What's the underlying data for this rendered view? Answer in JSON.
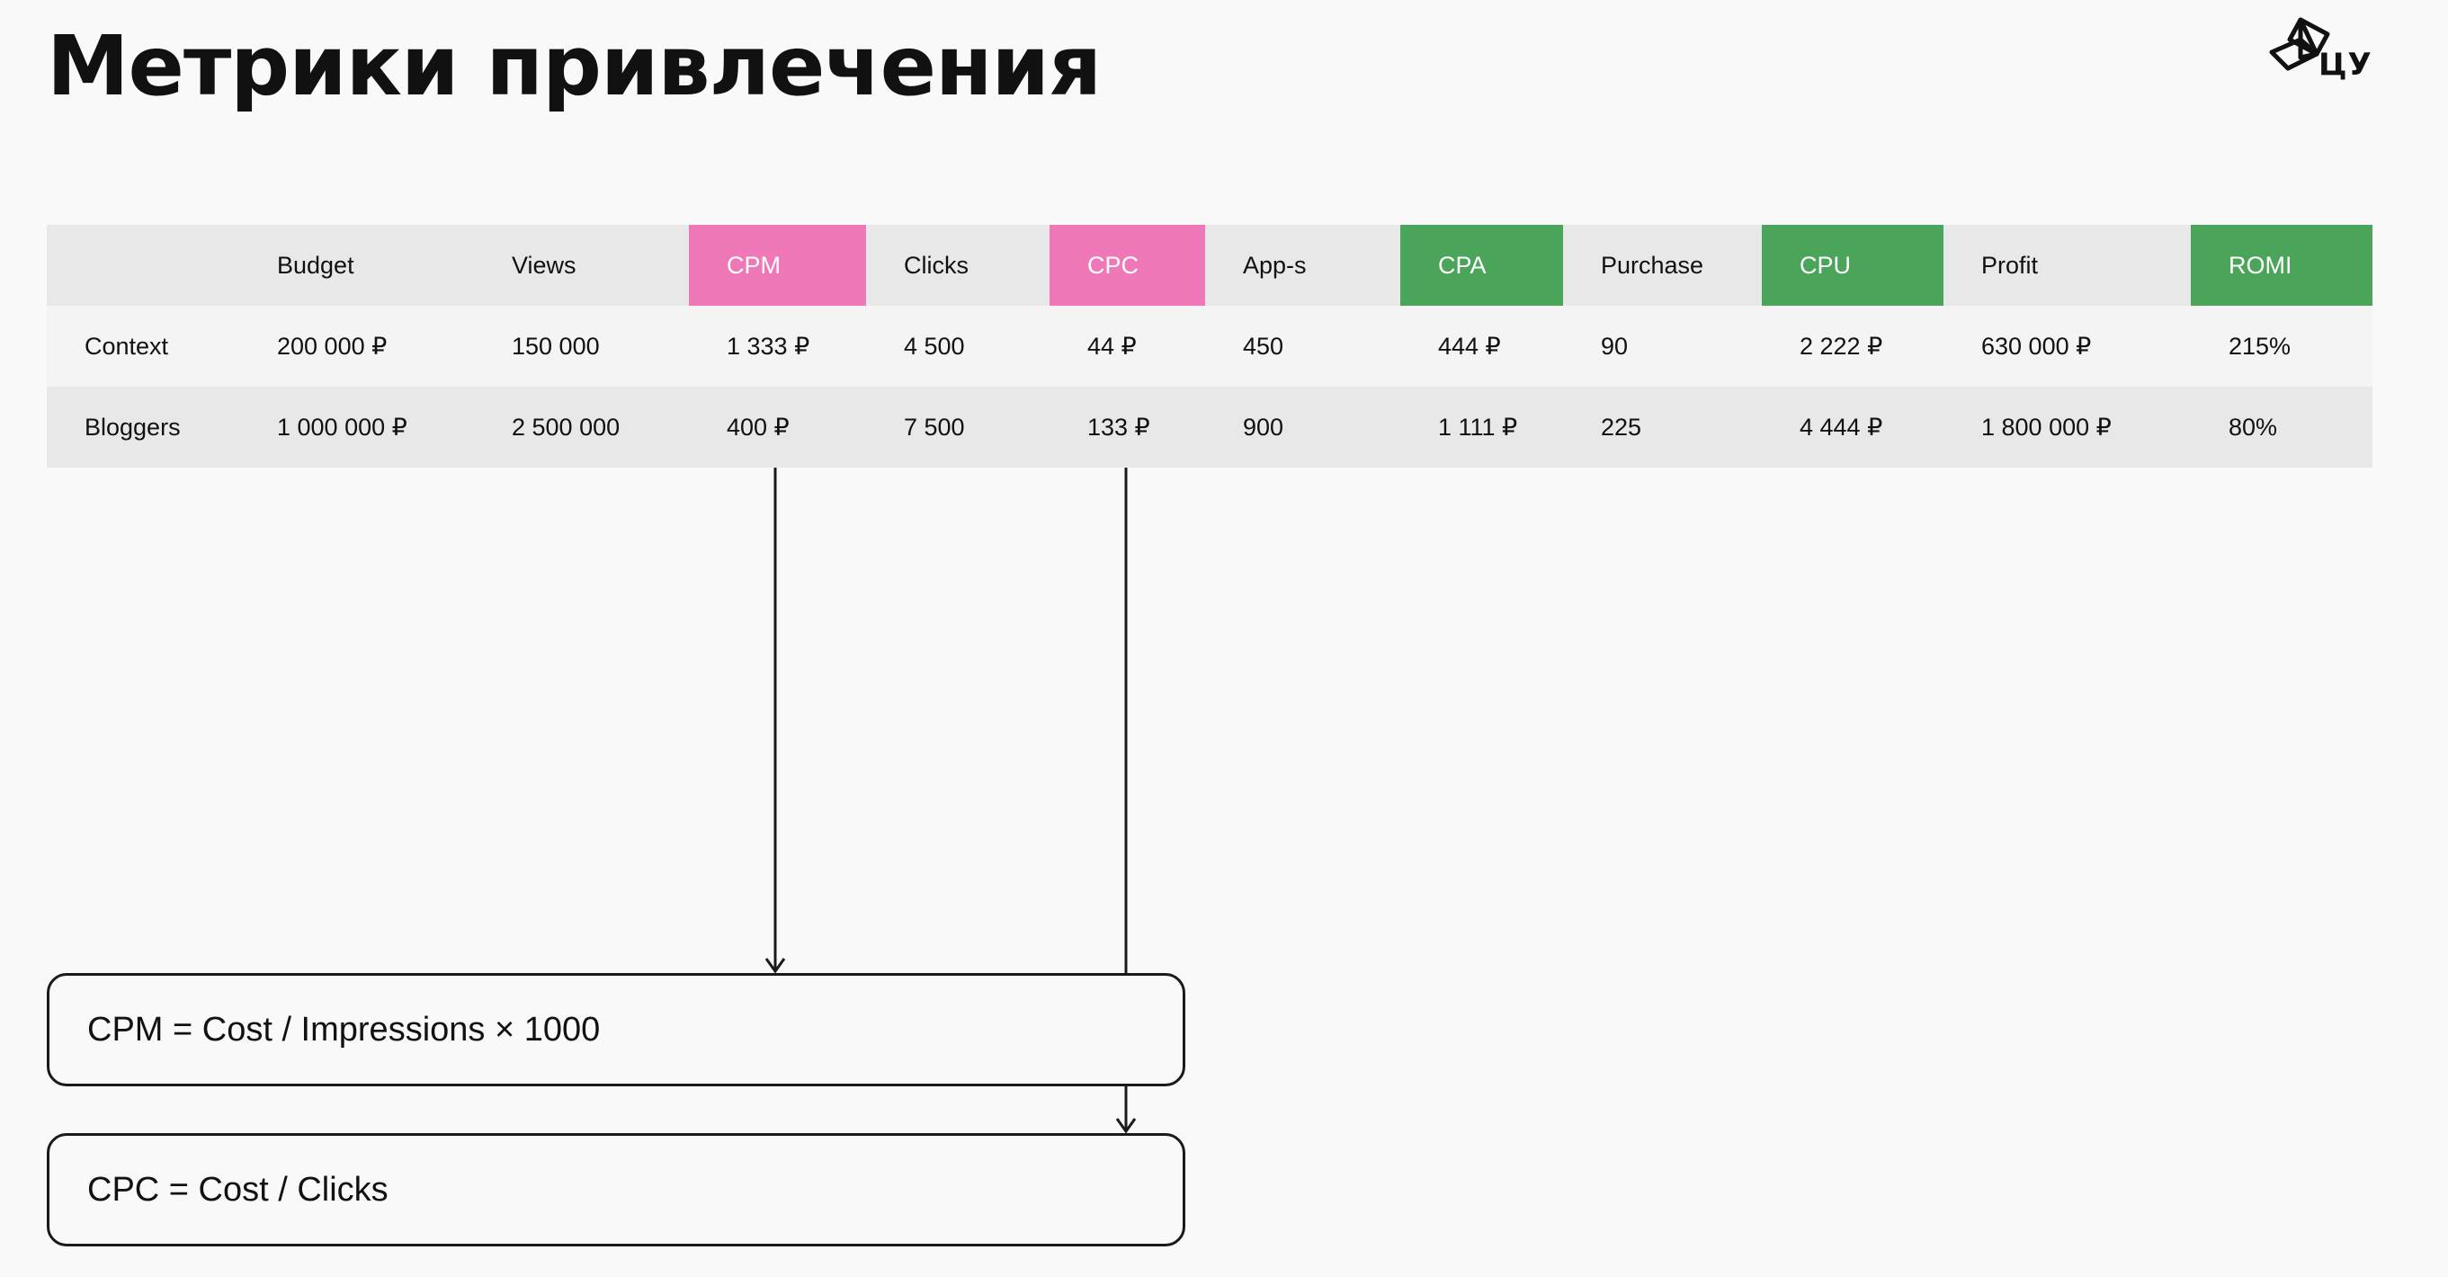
{
  "slide": {
    "title": "Метрики привлечения",
    "logo_text": "ЦУ"
  },
  "colors": {
    "pink_highlight": "#ef78b8",
    "green_highlight": "#4aa55a",
    "header_row_bg": "#e8e8e8",
    "row_bg_light": "#f4f4f4",
    "page_bg": "#f9f9f9"
  },
  "table": {
    "headers": [
      "",
      "Budget",
      "Views",
      "CPM",
      "Clicks",
      "CPC",
      "App-s",
      "CPA",
      "Purchase",
      "CPU",
      "Profit",
      "ROMI"
    ],
    "header_highlights": [
      "none",
      "none",
      "none",
      "pink",
      "none",
      "pink",
      "none",
      "green",
      "none",
      "green",
      "none",
      "green"
    ],
    "rows": [
      [
        "Context",
        "200 000 ₽",
        "150 000",
        "1 333 ₽",
        "4 500",
        "44 ₽",
        "450",
        "444 ₽",
        "90",
        "2 222 ₽",
        "630 000 ₽",
        "215%"
      ],
      [
        "Bloggers",
        "1 000 000 ₽",
        "2 500 000",
        "400 ₽",
        "7 500",
        "133 ₽",
        "900",
        "1 111 ₽",
        "225",
        "4 444 ₽",
        "1 800 000 ₽",
        "80%"
      ]
    ]
  },
  "formulas": {
    "cpm": "CPM = Cost / Impressions × 1000",
    "cpc": "CPC = Cost / Clicks"
  }
}
